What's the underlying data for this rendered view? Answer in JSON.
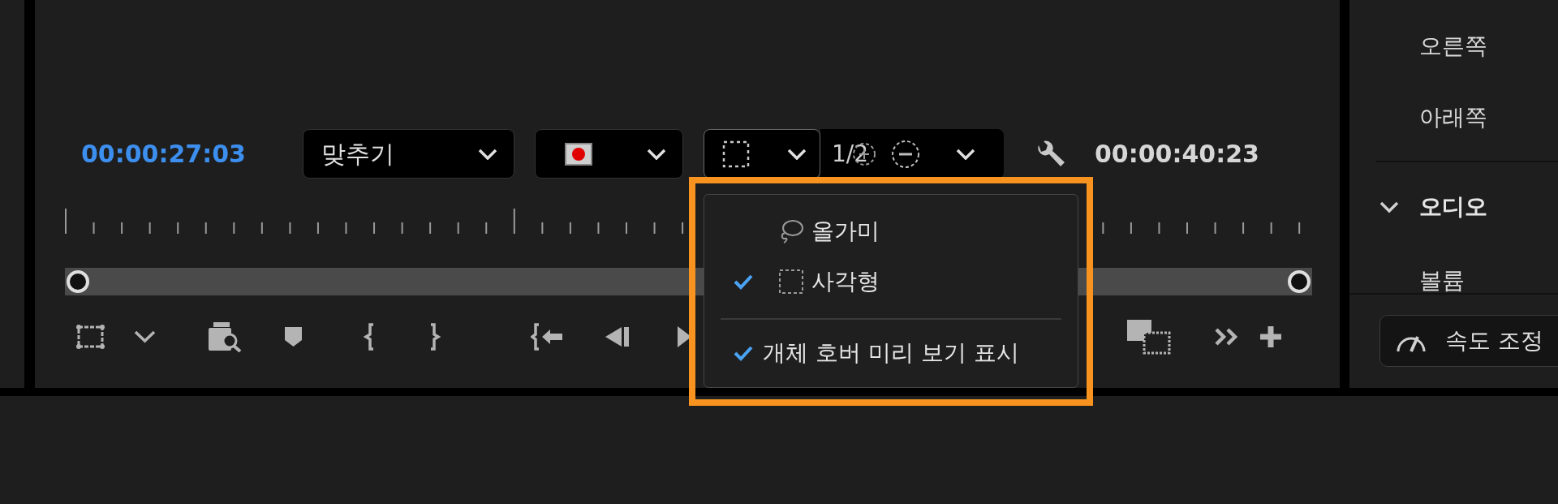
{
  "program_monitor": {
    "current_timecode": "00:00:27:03",
    "zoom_dropdown": {
      "value": "맞추기"
    },
    "selection_dropdown": {
      "expanded": true
    },
    "resolution": "1/2",
    "duration_timecode": "00:00:40:23"
  },
  "selection_menu": {
    "items": [
      {
        "kind": "lasso",
        "label": "올가미",
        "checked": false
      },
      {
        "kind": "rectangle",
        "label": "사각형",
        "checked": true
      },
      {
        "kind": "separator"
      },
      {
        "kind": "toggle",
        "label": "개체 호버 미리 보기 표시",
        "checked": true
      }
    ]
  },
  "effect_panel": {
    "items": [
      {
        "kind": "property",
        "label": "오른쪽"
      },
      {
        "kind": "property",
        "label": "아래쪽"
      },
      {
        "kind": "divider"
      },
      {
        "kind": "section",
        "label": "오디오",
        "expanded": true
      },
      {
        "kind": "property",
        "label": "볼륨"
      }
    ],
    "button": "속도 조정"
  }
}
